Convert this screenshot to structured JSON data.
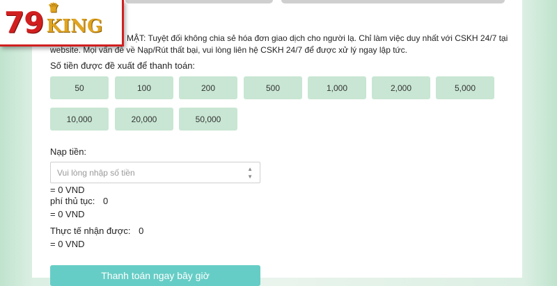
{
  "notice": {
    "text_line1": "MẬT: Tuyệt đối không chia sẻ hóa đơn giao dịch cho người lạ. Chỉ làm việc duy nhất với CSKH 24/7 tại",
    "text_line2": "website. Mọi vấn đề về Nạp/Rút thất bại, vui lòng liên hệ CSKH 24/7 để được xử lý ngay lập tức."
  },
  "suggested": {
    "label": "Số tiền được đề xuất để thanh toán:",
    "amounts": [
      "50",
      "100",
      "200",
      "500",
      "1,000",
      "2,000",
      "5,000",
      "10,000",
      "20,000",
      "50,000"
    ]
  },
  "deposit": {
    "label": "Nạp tiền:",
    "placeholder": "Vui lòng nhập số tiền",
    "converted": "= 0 VND"
  },
  "fee": {
    "label": "phí thủ tục:",
    "value": "0",
    "converted": "= 0 VND"
  },
  "received": {
    "label": "Thực tế nhận được:",
    "value": "0",
    "converted": "= 0 VND"
  },
  "pay_button": "Thanh toán ngay bây giờ",
  "logo": {
    "number": "79",
    "word": "KING"
  },
  "colors": {
    "amount_button": "#c8e6d3",
    "pay_button": "#66cdc6",
    "logo_red": "#d11f1f",
    "logo_gold": "#e0a420"
  },
  "icons": [
    "crown-icon",
    "spinner-up-icon",
    "spinner-down-icon"
  ]
}
